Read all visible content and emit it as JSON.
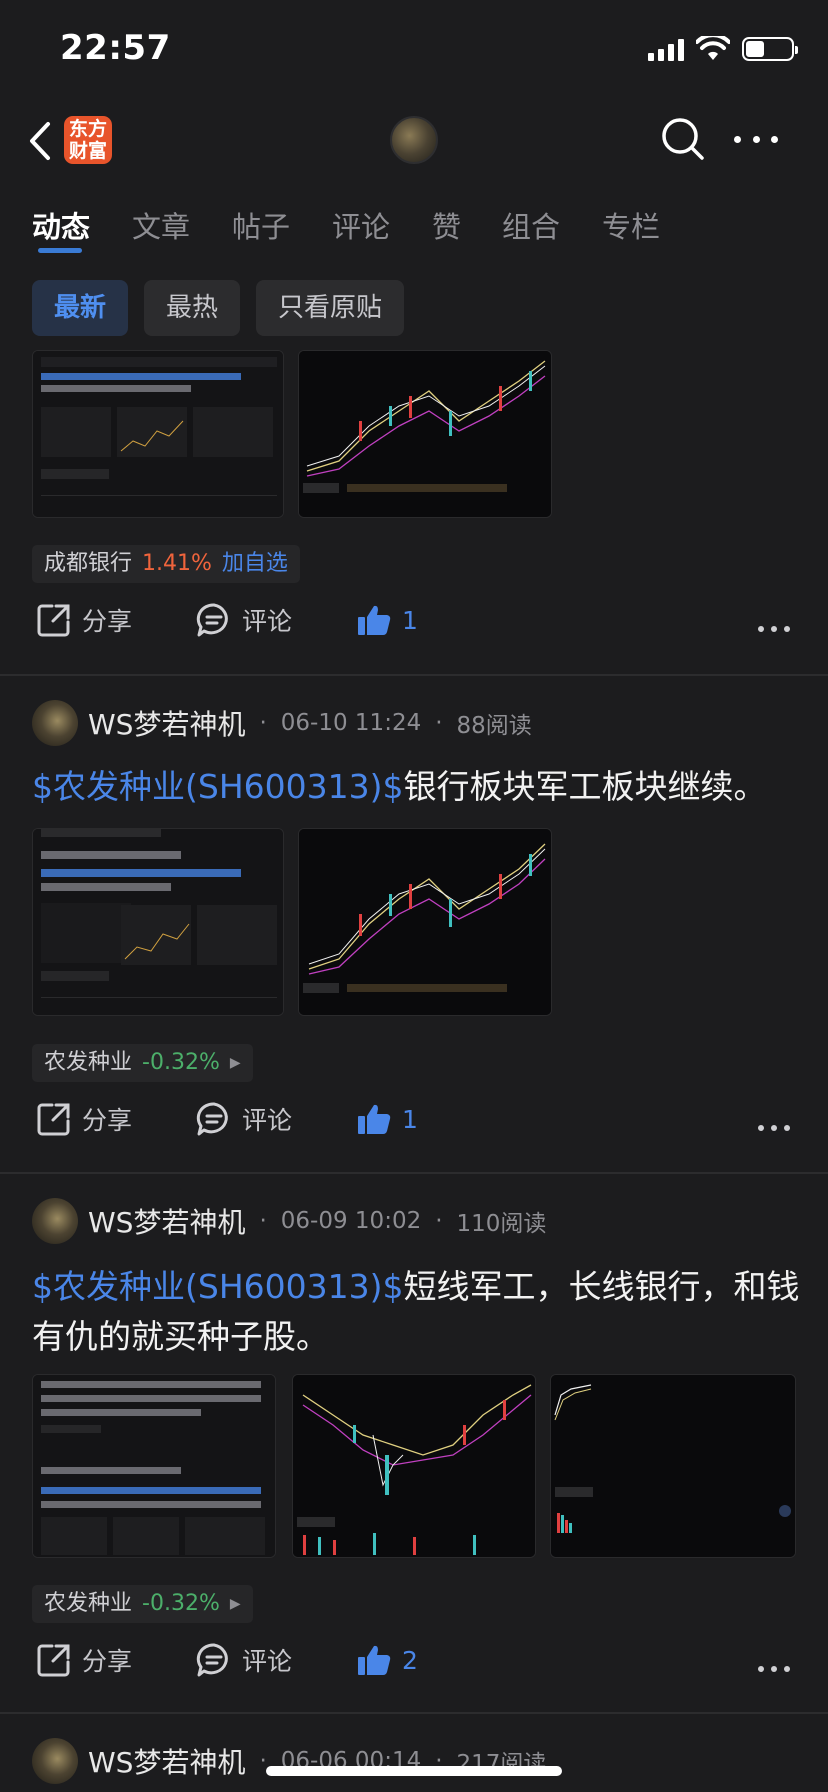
{
  "status_bar": {
    "time": "22:57"
  },
  "nav": {
    "logo_line1": "东方",
    "logo_line2": "财富"
  },
  "tabs": [
    {
      "label": "动态"
    },
    {
      "label": "文章"
    },
    {
      "label": "帖子"
    },
    {
      "label": "评论"
    },
    {
      "label": "赞"
    },
    {
      "label": "组合"
    },
    {
      "label": "专栏"
    }
  ],
  "filters": [
    {
      "label": "最新"
    },
    {
      "label": "最热"
    },
    {
      "label": "只看原贴"
    }
  ],
  "posts": [
    {
      "stock_chip": {
        "name": "成都银行",
        "change": "1.41%",
        "action": "加自选"
      },
      "actions": {
        "share": "分享",
        "comment": "评论",
        "likes": "1"
      }
    },
    {
      "author": "WS梦若神机",
      "date": "06-10 11:24",
      "reads": "88阅读",
      "stock_link": "$农发种业(SH600313)$",
      "text": "银行板块军工板块继续。",
      "stock_chip": {
        "name": "农发种业",
        "change": "-0.32%"
      },
      "actions": {
        "share": "分享",
        "comment": "评论",
        "likes": "1"
      }
    },
    {
      "author": "WS梦若神机",
      "date": "06-09 10:02",
      "reads": "110阅读",
      "stock_link": "$农发种业(SH600313)$",
      "text": "短线军工，长线银行，和钱有仇的就买种子股。",
      "stock_chip": {
        "name": "农发种业",
        "change": "-0.32%"
      },
      "actions": {
        "share": "分享",
        "comment": "评论",
        "likes": "2"
      }
    },
    {
      "author": "WS梦若神机",
      "date": "06-06 00:14",
      "reads": "217阅读"
    }
  ],
  "colors": {
    "accent": "#4a86e8",
    "up": "#f0643c",
    "down": "#4caf6a",
    "bg": "#1c1c1e"
  }
}
